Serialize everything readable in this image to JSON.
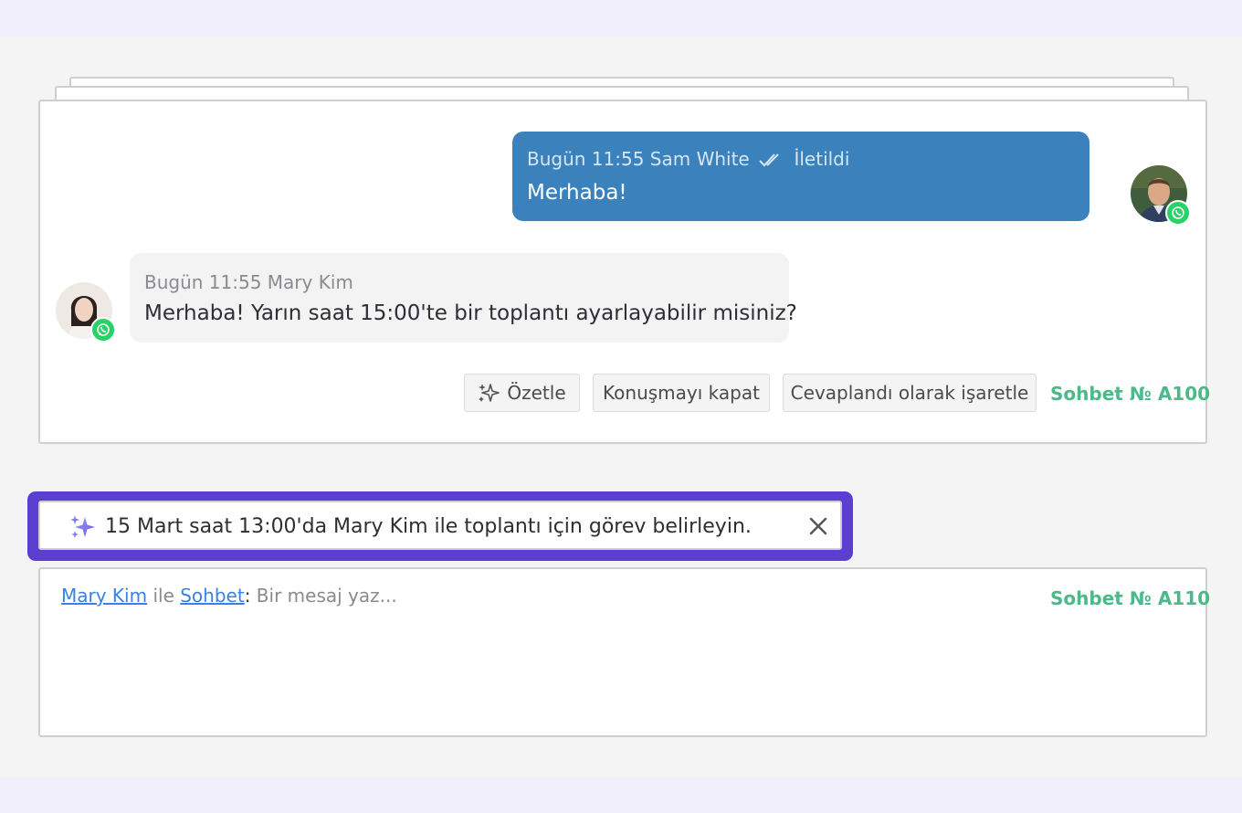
{
  "conversation": {
    "outgoing": {
      "meta_prefix": "Bugün 11:55 Sam White",
      "status": "İletildi",
      "text": "Merhaba!"
    },
    "incoming": {
      "meta": "Bugün 11:55 Mary Kim",
      "text": "Merhaba! Yarın saat 15:00'te bir toplantı ayarlayabilir misiniz?"
    },
    "actions": {
      "summarize": "Özetle",
      "close": "Konuşmayı kapat",
      "mark_answered": "Cevaplandı olarak işaretle"
    },
    "chat_number": "Sohbet № A100"
  },
  "suggestion": {
    "text": "15 Mart saat 13:00'da Mary Kim ile toplantı için görev belirleyin."
  },
  "composer": {
    "contact": "Mary Kim",
    "with": "ile",
    "channel": "Sohbet",
    "colon": ":",
    "placeholder": "Bir mesaj yaz...",
    "chat_number": "Sohbet № A110"
  },
  "colors": {
    "outgoing_bubble": "#3b82bd",
    "chat_number": "#4cb98a",
    "suggestion_highlight": "#5b3fd0",
    "whatsapp": "#25d366",
    "link": "#3b82e0"
  }
}
